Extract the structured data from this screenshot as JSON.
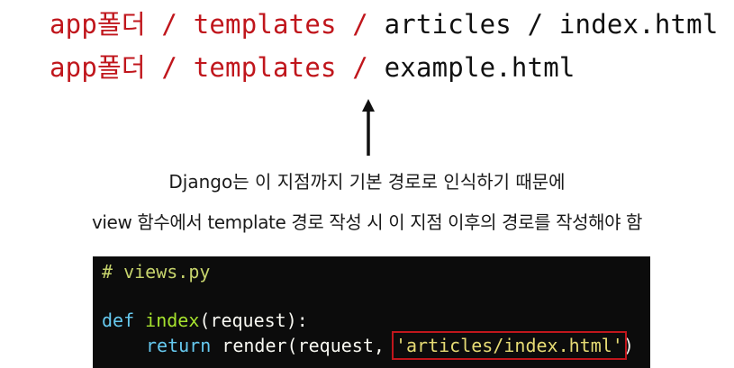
{
  "paths": {
    "line1": {
      "prefix": "app폴더 / templates / ",
      "rest": "articles / index.html"
    },
    "line2": {
      "prefix": "app폴더 / templates / ",
      "rest": "example.html"
    }
  },
  "captions": {
    "line1": "Django는 이 지점까지 기본 경로로 인식하기 때문에",
    "line2": "view 함수에서 template 경로 작성 시 이 지점 이후의 경로를 작성해야 함"
  },
  "code": {
    "comment": "# views.py",
    "def_keyword": "def",
    "func_name": "index",
    "func_params": "(request):",
    "return_keyword": "return",
    "render_call": "render(request, ",
    "template_string": "'articles/index.html'",
    "close_paren": ")"
  },
  "colors": {
    "accent_red": "#c0161c",
    "code_bg": "#0c0c0c"
  }
}
